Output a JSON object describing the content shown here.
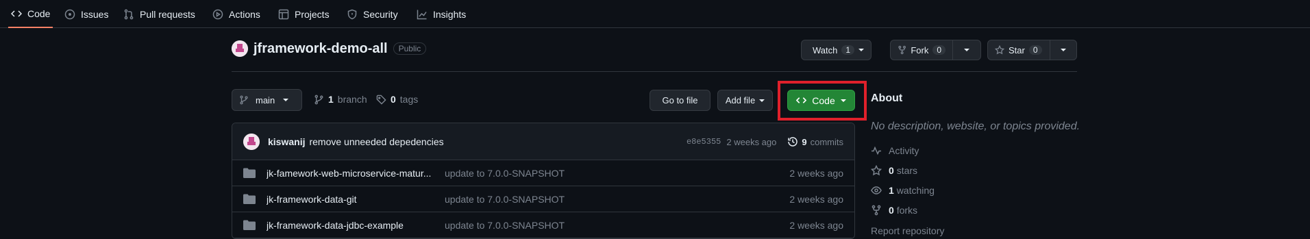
{
  "nav": {
    "tabs": [
      {
        "label": "Code",
        "icon": "code-icon",
        "active": true
      },
      {
        "label": "Issues",
        "icon": "issue-icon"
      },
      {
        "label": "Pull requests",
        "icon": "pull-request-icon"
      },
      {
        "label": "Actions",
        "icon": "play-icon"
      },
      {
        "label": "Projects",
        "icon": "table-icon"
      },
      {
        "label": "Security",
        "icon": "shield-icon"
      },
      {
        "label": "Insights",
        "icon": "graph-icon"
      }
    ]
  },
  "repo": {
    "name": "jframework-demo-all",
    "visibility": "Public"
  },
  "actions": {
    "watch_label": "Watch",
    "watch_count": "1",
    "fork_label": "Fork",
    "fork_count": "0",
    "star_label": "Star",
    "star_count": "0"
  },
  "toolbar": {
    "branch": "main",
    "branches_count": "1",
    "branches_label": "branch",
    "tags_count": "0",
    "tags_label": "tags",
    "go_to_file": "Go to file",
    "add_file": "Add file",
    "code": "Code"
  },
  "commit": {
    "author": "kiswanij",
    "message": "remove unneeded depedencies",
    "sha": "e8e5355",
    "age": "2 weeks ago",
    "commits_count": "9",
    "commits_label": "commits"
  },
  "files": [
    {
      "name": "jk-famework-web-microservice-matur...",
      "message": "update to 7.0.0-SNAPSHOT",
      "age": "2 weeks ago"
    },
    {
      "name": "jk-framework-data-git",
      "message": "update to 7.0.0-SNAPSHOT",
      "age": "2 weeks ago"
    },
    {
      "name": "jk-framework-data-jdbc-example",
      "message": "update to 7.0.0-SNAPSHOT",
      "age": "2 weeks ago"
    }
  ],
  "about": {
    "title": "About",
    "description": "No description, website, or topics provided.",
    "activity": "Activity",
    "stars_count": "0",
    "stars_label": "stars",
    "watching_count": "1",
    "watching_label": "watching",
    "forks_count": "0",
    "forks_label": "forks",
    "report": "Report repository"
  },
  "colors": {
    "accent_tab": "#f78166",
    "code_button": "#238636",
    "highlight_box": "#e0202b",
    "folder": "#7d8590"
  }
}
